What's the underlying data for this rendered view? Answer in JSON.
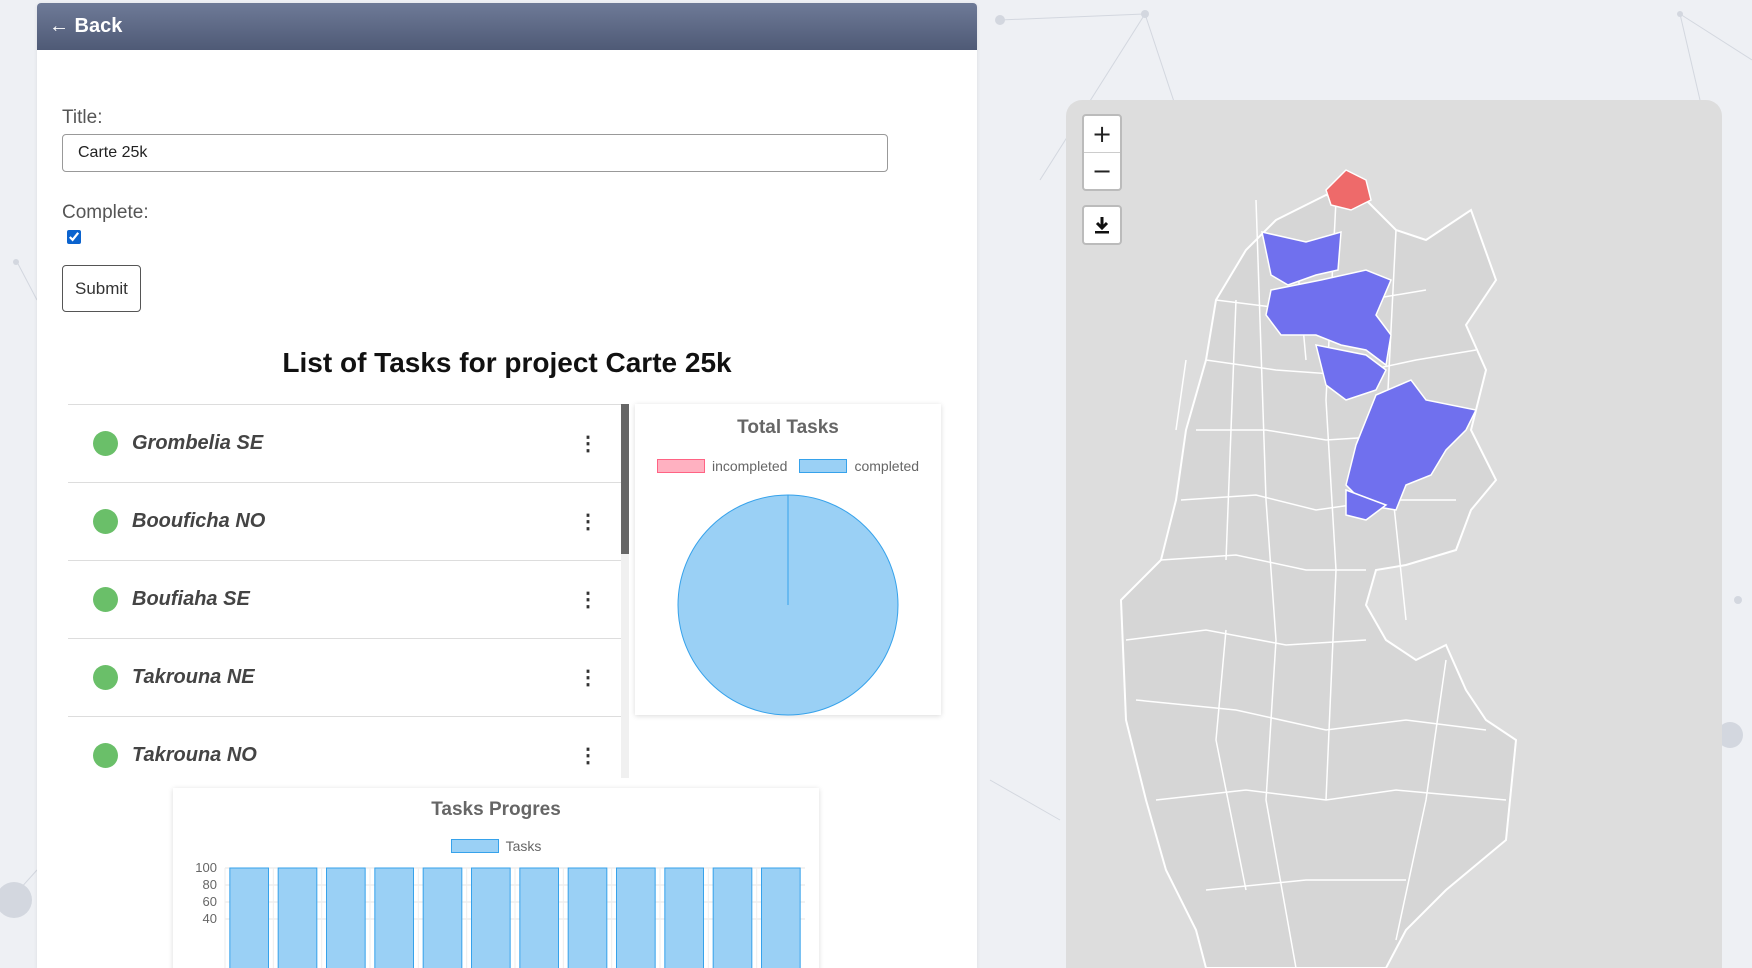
{
  "nav": {
    "back_label": "← Back"
  },
  "form": {
    "title_label": "Title:",
    "title_value": "Carte 25k",
    "complete_label": "Complete:",
    "complete_checked": true,
    "submit_label": "Submit"
  },
  "list": {
    "heading": "List of Tasks for project Carte 25k",
    "status_color": "#6abf69",
    "items": [
      {
        "name": "Grombelia SE"
      },
      {
        "name": "Boouficha NO"
      },
      {
        "name": "Boufiaha SE"
      },
      {
        "name": "Takrouna NE"
      },
      {
        "name": "Takrouna NO"
      }
    ]
  },
  "chart_data": [
    {
      "type": "pie",
      "title": "Total Tasks",
      "legend": [
        "incompleted",
        "completed"
      ],
      "values": [
        0,
        100
      ],
      "colors": [
        "#ffb1c1",
        "#9ad0f5"
      ],
      "legend_position": "top"
    },
    {
      "type": "bar",
      "title": "Tasks Progres",
      "series": [
        {
          "name": "Tasks",
          "values": [
            100,
            100,
            100,
            100,
            100,
            100,
            100,
            100,
            100,
            100,
            100,
            100
          ]
        }
      ],
      "ylim": [
        0,
        100
      ],
      "yticks": [
        100,
        80,
        60,
        40
      ],
      "grid": true,
      "legend_position": "top",
      "color": "#9ad0f5"
    }
  ],
  "map": {
    "zoom_in": "+",
    "zoom_out": "−",
    "download_icon": "download-icon",
    "fill_default": "#d6d6d6",
    "fill_complete": "#7070ee",
    "fill_selected": "#ee6a6a"
  }
}
